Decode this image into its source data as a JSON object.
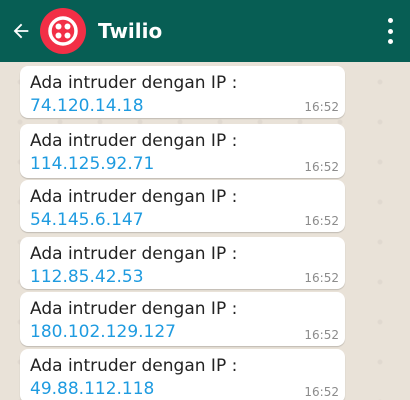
{
  "header": {
    "title": "Twilio",
    "back_icon": "arrow-left-icon",
    "avatar_icon": "twilio-logo-icon",
    "menu_icon": "more-vert-icon",
    "colors": {
      "bar": "#075e54",
      "avatar": "#f22f46"
    }
  },
  "messages": [
    {
      "prefix": "Ada intruder dengan IP : ",
      "ip": "74.120.14.18",
      "time": "16:52"
    },
    {
      "prefix": "Ada intruder dengan IP : ",
      "ip": "114.125.92.71",
      "time": "16:52"
    },
    {
      "prefix": "Ada intruder dengan IP : ",
      "ip": "54.145.6.147",
      "time": "16:52"
    },
    {
      "prefix": "Ada intruder dengan IP : ",
      "ip": "112.85.42.53",
      "time": "16:52"
    },
    {
      "prefix": "Ada intruder dengan IP : ",
      "ip": "180.102.129.127",
      "time": "16:52"
    },
    {
      "prefix": "Ada intruder dengan IP : ",
      "ip": "49.88.112.118",
      "time": "16:52"
    }
  ],
  "colors": {
    "ip_text": "#1e9be0",
    "bubble": "#ffffff",
    "background": "#e9e2d8"
  }
}
